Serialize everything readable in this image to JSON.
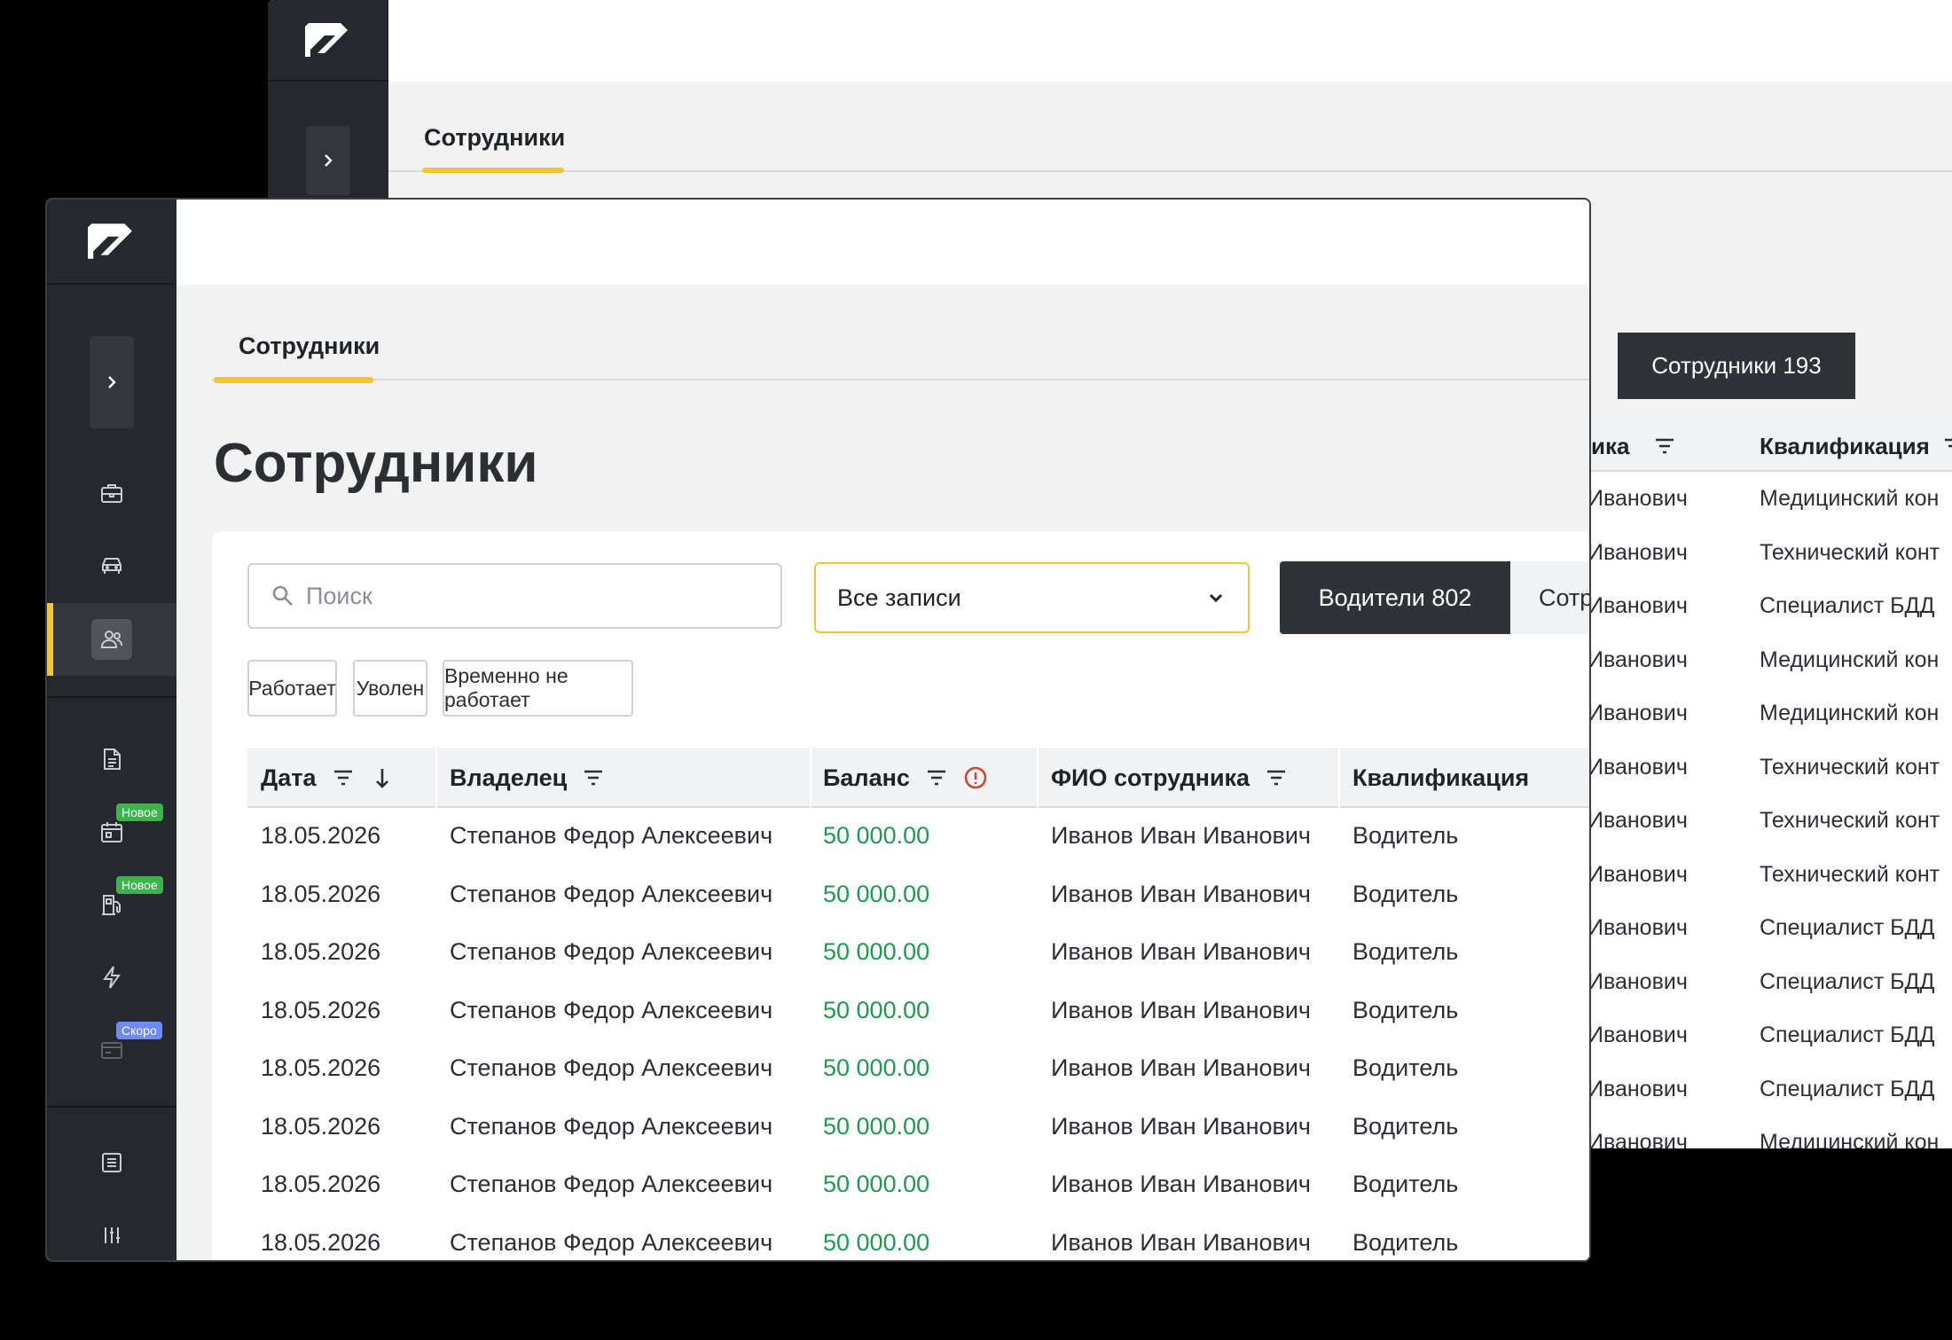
{
  "back_window": {
    "tab_label": "Сотрудники",
    "segment_label": "Сотрудники 193",
    "columns": [
      "ика",
      "Квалификация"
    ],
    "rows": [
      [
        "Иванович",
        "Медицинский кон"
      ],
      [
        "Иванович",
        "Технический конт"
      ],
      [
        "Иванович",
        "Специалист БДД"
      ],
      [
        "Иванович",
        "Медицинский кон"
      ],
      [
        "Иванович",
        "Медицинский кон"
      ],
      [
        "Иванович",
        "Технический конт"
      ],
      [
        "Иванович",
        "Технический конт"
      ],
      [
        "Иванович",
        "Технический конт"
      ],
      [
        "Иванович",
        "Специалист БДД"
      ],
      [
        "Иванович",
        "Специалист БДД"
      ],
      [
        "Иванович",
        "Специалист БДД"
      ],
      [
        "Иванович",
        "Специалист БДД"
      ],
      [
        "Иванович",
        "Медицинский кон"
      ]
    ]
  },
  "sidebar": {
    "badges": {
      "new1": "Новое",
      "new2": "Новое",
      "soon": "Скоро"
    }
  },
  "tabs": {
    "employees": "Сотрудники"
  },
  "page": {
    "title": "Сотрудники"
  },
  "filters": {
    "search_placeholder": "Поиск",
    "select_value": "Все записи",
    "segment_active": "Водители 802",
    "segment_inactive": "Сотрудники",
    "chips": [
      "Работает",
      "Уволен",
      "Временно не работает"
    ]
  },
  "table": {
    "columns": {
      "date": "Дата",
      "owner": "Владелец",
      "balance": "Баланс",
      "employee": "ФИО сотрудника",
      "qualification": "Квалификация"
    },
    "rows": [
      {
        "date": "18.05.2026",
        "owner": "Степанов Федор Алексеевич",
        "balance": "50 000.00",
        "employee": "Иванов Иван Иванович",
        "qualification": "Водитель"
      },
      {
        "date": "18.05.2026",
        "owner": "Степанов Федор Алексеевич",
        "balance": "50 000.00",
        "employee": "Иванов Иван Иванович",
        "qualification": "Водитель"
      },
      {
        "date": "18.05.2026",
        "owner": "Степанов Федор Алексеевич",
        "balance": "50 000.00",
        "employee": "Иванов Иван Иванович",
        "qualification": "Водитель"
      },
      {
        "date": "18.05.2026",
        "owner": "Степанов Федор Алексеевич",
        "balance": "50 000.00",
        "employee": "Иванов Иван Иванович",
        "qualification": "Водитель"
      },
      {
        "date": "18.05.2026",
        "owner": "Степанов Федор Алексеевич",
        "balance": "50 000.00",
        "employee": "Иванов Иван Иванович",
        "qualification": "Водитель"
      },
      {
        "date": "18.05.2026",
        "owner": "Степанов Федор Алексеевич",
        "balance": "50 000.00",
        "employee": "Иванов Иван Иванович",
        "qualification": "Водитель"
      },
      {
        "date": "18.05.2026",
        "owner": "Степанов Федор Алексеевич",
        "balance": "50 000.00",
        "employee": "Иванов Иван Иванович",
        "qualification": "Водитель"
      },
      {
        "date": "18.05.2026",
        "owner": "Степанов Федор Алексеевич",
        "balance": "50 000.00",
        "employee": "Иванов Иван Иванович",
        "qualification": "Водитель"
      }
    ]
  },
  "colors": {
    "accent": "#f5c431",
    "dark": "#25282c",
    "positive": "#1e9a4f",
    "warning": "#d64430"
  }
}
